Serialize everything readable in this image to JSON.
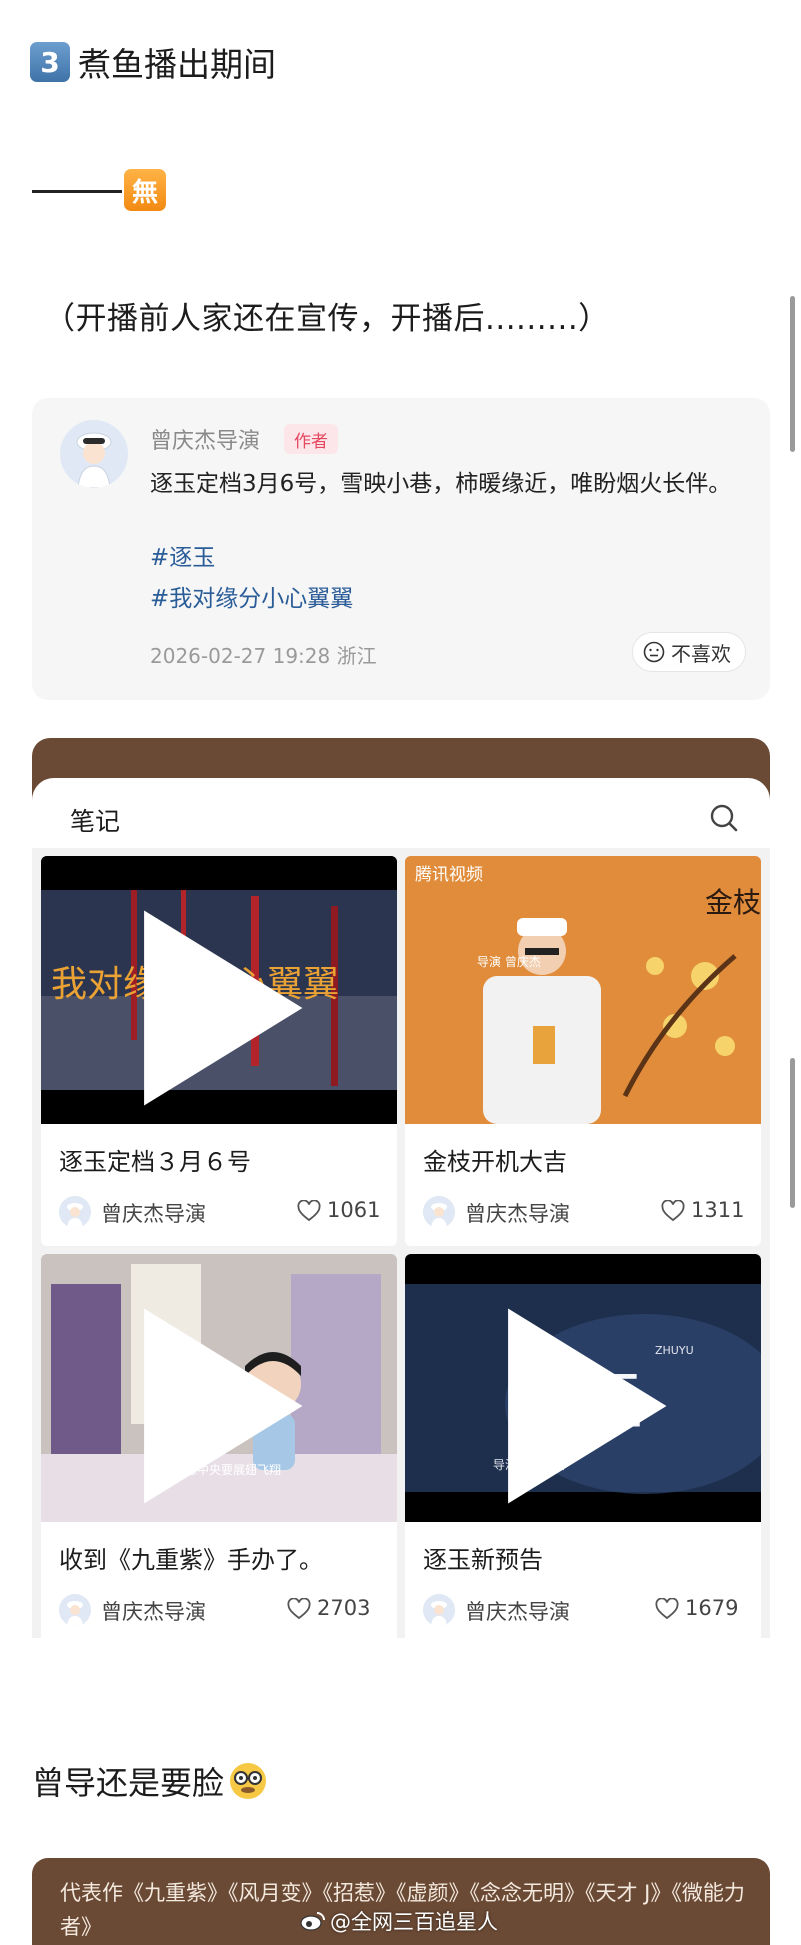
{
  "heading": {
    "number": "3",
    "title": "煮鱼播出期间"
  },
  "symbol_badge": "無",
  "paren_text": "（开播前人家还在宣传，开播后.........）",
  "post": {
    "author": "曾庆杰导演",
    "author_tag": "作者",
    "text": "逐玉定档3月6号，雪映小巷，柿暖缘近，唯盼烟火长伴。",
    "hashtags": [
      "#逐玉",
      "#我对缘分小心翼翼"
    ],
    "time_location": "2026-02-27 19:28 浙江",
    "dislike_label": "不喜欢"
  },
  "notes": {
    "title": "笔记",
    "items": [
      {
        "title": "逐玉定档３月６号",
        "author": "曾庆杰导演",
        "likes": "1061"
      },
      {
        "title": "金枝开机大吉",
        "author": "曾庆杰导演",
        "likes": "1311"
      },
      {
        "title": "收到《九重紫》手办了。",
        "author": "曾庆杰导演",
        "likes": "2703"
      },
      {
        "title": "逐玉新预告",
        "author": "曾庆杰导演",
        "likes": "1679"
      }
    ],
    "thumb_texts": {
      "note1": "我对缘分小心翼翼",
      "note2_brand": "腾讯视频",
      "note2_title": "金枝",
      "note2_credit": "导演 曾庆杰",
      "note3_caption": "在梦想中央要展翅飞翔",
      "note4_title": "逐玉",
      "note4_credit": "导演 / 曾庆杰",
      "note4_pinyin": "ZHUYU"
    }
  },
  "bottom_heading": "曾导还是要脸",
  "works": "代表作《九重紫》《风月变》《招惹》《虚颜》《念念无明》《天才 J》《微能力者》",
  "watermark": "@全网三百追星人",
  "colors": {
    "accent_brown": "#6b4a35",
    "hashtag_blue": "#2a5d98",
    "tag_red": "#e64760"
  }
}
